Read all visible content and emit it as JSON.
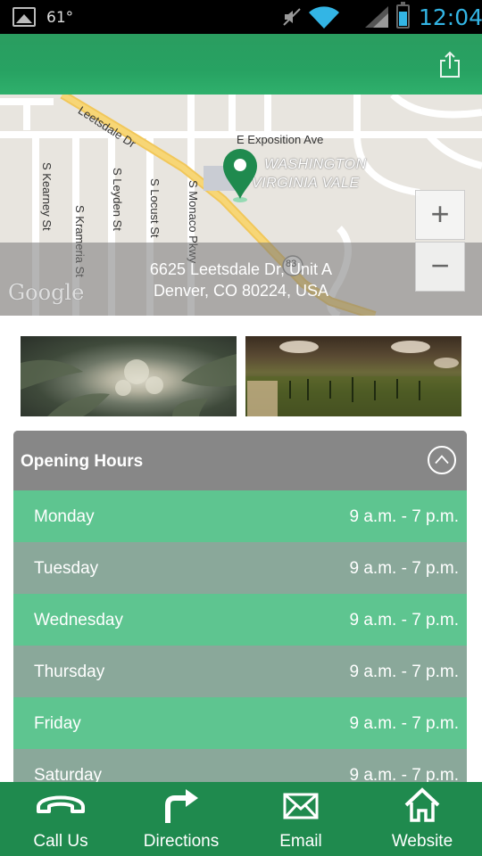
{
  "status_bar": {
    "temperature": "61°",
    "time": "12:04",
    "clock_color": "#33b5e5",
    "icons": [
      "image-icon",
      "mute-icon",
      "wifi-icon",
      "signal-icon",
      "battery-icon"
    ]
  },
  "app_bar": {
    "accent": "#27a262",
    "share_icon": "share-icon"
  },
  "map": {
    "streets": {
      "leetsdale": "Leetsdale Dr",
      "exposition": "E Exposition Ave",
      "kearney": "S Kearney St",
      "krameria": "S Krameria St",
      "leyden": "S Leyden St",
      "locust": "S Locust St",
      "monaco": "S Monaco Pkwy",
      "route": "83"
    },
    "area_line1": "WASHINGTON",
    "area_line2": "VIRGINIA VALE",
    "address_line1": "6625 Leetsdale Dr, Unit A",
    "address_line2": "Denver, CO 80224, USA",
    "attribution": "Google",
    "zoom_in": "+",
    "zoom_out": "−"
  },
  "hours": {
    "title": "Opening Hours",
    "days": [
      {
        "day": "Monday",
        "time": "9 a.m. - 7 p.m."
      },
      {
        "day": "Tuesday",
        "time": "9 a.m. - 7 p.m."
      },
      {
        "day": "Wednesday",
        "time": "9 a.m. - 7 p.m."
      },
      {
        "day": "Thursday",
        "time": "9 a.m. - 7 p.m."
      },
      {
        "day": "Friday",
        "time": "9 a.m. - 7 p.m."
      },
      {
        "day": "Saturday",
        "time": "9 a.m. - 7 p.m."
      }
    ],
    "row_colors": [
      "#5ec590",
      "#8aa89a"
    ]
  },
  "bottom_bar": {
    "color": "#1f8a4e",
    "tabs": [
      {
        "label": "Call Us",
        "icon": "phone-icon"
      },
      {
        "label": "Directions",
        "icon": "turn-right-arrow-icon"
      },
      {
        "label": "Email",
        "icon": "envelope-icon"
      },
      {
        "label": "Website",
        "icon": "home-icon"
      }
    ]
  }
}
